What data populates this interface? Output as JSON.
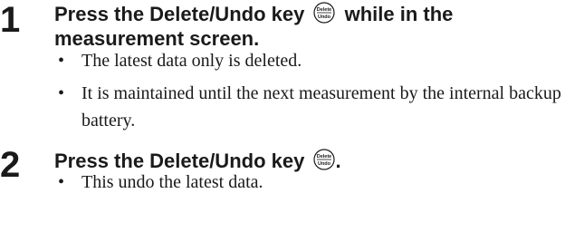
{
  "steps": [
    {
      "number": "1",
      "heading_before": "Press the Delete/Undo key",
      "heading_after": "while in the measurement screen.",
      "key_icon": {
        "top": "Delete",
        "bottom": "Undo"
      },
      "bullets": [
        "The latest data only is deleted.",
        "It is maintained until the next measurement by the internal backup battery."
      ]
    },
    {
      "number": "2",
      "heading_before": "Press the Delete/Undo key",
      "heading_after": ".",
      "key_icon": {
        "top": "Delete",
        "bottom": "Undo"
      },
      "bullets": [
        "This undo the latest data."
      ]
    }
  ],
  "bullet_symbol": "•"
}
